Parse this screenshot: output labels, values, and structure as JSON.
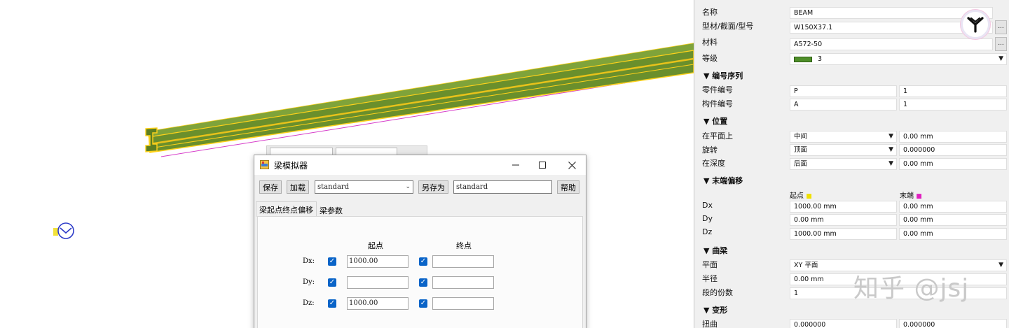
{
  "viewport": {
    "beam_color": "#6a8f2c",
    "outline_color": "#ffd21a",
    "magenta_line": "#d63cc9",
    "mini_toolbar": {
      "field1": "",
      "field2": ""
    },
    "icons": [
      "work-plane-icon",
      "pan-icon"
    ]
  },
  "dialog": {
    "title": "梁模拟器",
    "icon": "beam-simulator-icon",
    "toolbar": {
      "save": "保存",
      "load": "加载",
      "preset": "standard",
      "save_as": "另存为",
      "save_as_name": "standard",
      "help": "帮助"
    },
    "tabs": [
      "梁起点终点偏移",
      "梁参数"
    ],
    "active_tab": 0,
    "columns": {
      "start": "起点",
      "end": "终点"
    },
    "rows": [
      {
        "label": "Dx:",
        "start_checked": true,
        "start_value": "1000.00",
        "end_checked": true,
        "end_value": ""
      },
      {
        "label": "Dy:",
        "start_checked": true,
        "start_value": "",
        "end_checked": true,
        "end_value": ""
      },
      {
        "label": "Dz:",
        "start_checked": true,
        "start_value": "1000.00",
        "end_checked": true,
        "end_value": ""
      }
    ]
  },
  "props": {
    "general": {
      "name_label": "名称",
      "name_value": "BEAM",
      "profile_label": "型材/截面/型号",
      "profile_value": "W150X37.1",
      "material_label": "材料",
      "material_value": "A572-50",
      "class_label": "等级",
      "class_value": "3",
      "class_color": "#4f8f2a"
    },
    "numbering": {
      "title": "▼ 编号序列",
      "part_label": "零件编号",
      "part_prefix": "P",
      "part_start": "1",
      "assembly_label": "构件编号",
      "assembly_prefix": "A",
      "assembly_start": "1"
    },
    "position": {
      "title": "▼ 位置",
      "plane_label": "在平面上",
      "plane_value": "中间",
      "plane_offset": "0.00 mm",
      "rotation_label": "旋转",
      "rotation_value": "顶面",
      "rotation_offset": "0.000000",
      "depth_label": "在深度",
      "depth_value": "后面",
      "depth_offset": "0.00 mm"
    },
    "end_offset": {
      "title": "▼ 末端偏移",
      "start_label": "起点",
      "end_label": "末端",
      "dx_label": "Dx",
      "dx_start": "1000.00 mm",
      "dx_end": "0.00 mm",
      "dy_label": "Dy",
      "dy_start": "0.00 mm",
      "dy_end": "0.00 mm",
      "dz_label": "Dz",
      "dz_start": "1000.00 mm",
      "dz_end": "0.00 mm"
    },
    "curved": {
      "title": "▼ 曲梁",
      "plane_label": "平面",
      "plane_value": "XY 平面",
      "radius_label": "半径",
      "radius_value": "0.00 mm",
      "segments_label": "段的份数",
      "segments_value": "1"
    },
    "deform": {
      "title": "▼ 变形",
      "twist_label": "扭曲",
      "twist_start": "0.000000",
      "twist_end": "0.000000"
    },
    "ellipsis": "..."
  },
  "watermark": "知乎 @jsj"
}
